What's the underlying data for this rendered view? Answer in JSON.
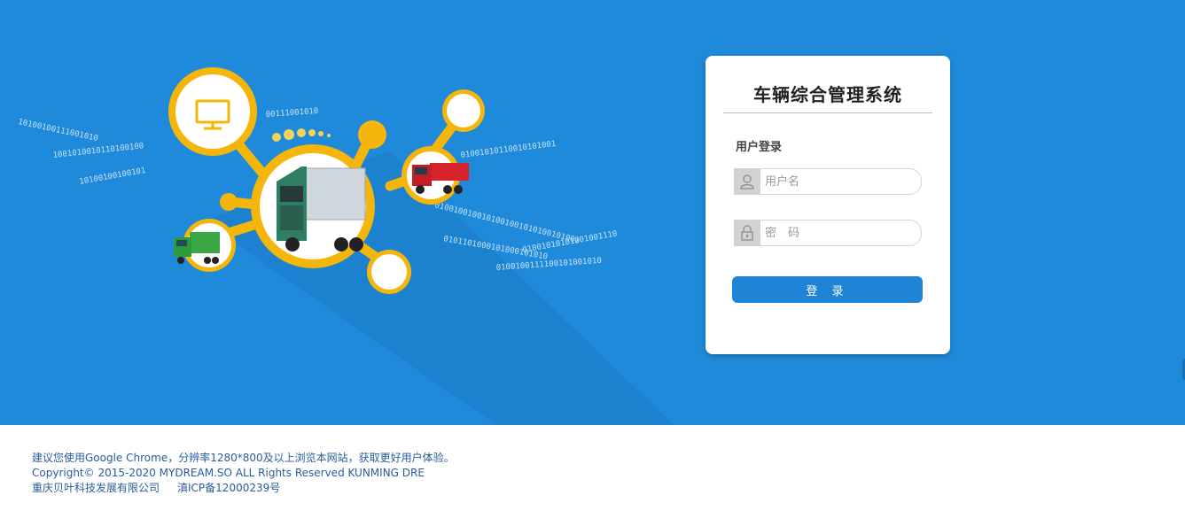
{
  "login": {
    "title": "车辆综合管理系统",
    "section_label": "用户登录",
    "username_placeholder": "用户名",
    "password_placeholder": "密　码",
    "submit_label": "登 录"
  },
  "illustration": {
    "binary_strings": [
      "10100100111001010",
      "00111001010",
      "10100100100101",
      "1001010010110100100",
      "01001010110010101001",
      "0100100100101001001010100101001",
      "01001010101001001110",
      "0101101000101000101010",
      "0100100111100101001010"
    ]
  },
  "footer": {
    "line1": "建议您使用Google Chrome，分辨率1280*800及以上浏览本网站，获取更好用户体验。",
    "line2": "Copyright© 2015-2020 MYDREAM.SO ALL Rights Reserved KUNMING DRE",
    "company": "重庆贝叶科技发展有限公司",
    "icp": "滇ICP备12000239号"
  },
  "colors": {
    "background": "#1f8ad9",
    "accent_yellow": "#f5b60c",
    "button": "#1f84d6"
  }
}
